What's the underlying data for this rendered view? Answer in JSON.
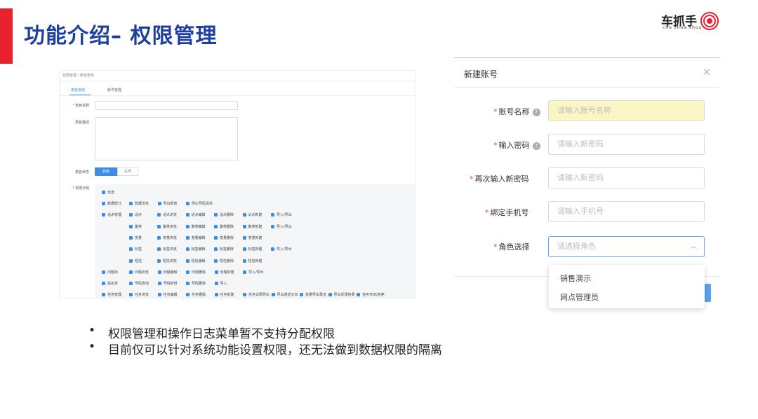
{
  "title": "功能介绍– 权限管理",
  "logo": {
    "text": "车抓手",
    "sub": "che zhua shou"
  },
  "left_panel": {
    "breadcrumb": "权限管理 / 新建角色",
    "tabs": [
      "角色管理",
      "账号管理"
    ],
    "labels": {
      "name": "角色名称",
      "desc": "角色描述",
      "status": "角色状态",
      "perm": "权限分配"
    },
    "status_on": "启用",
    "status_off": "关闭",
    "select_all": "全选",
    "rows": [
      {
        "group": "数据统计",
        "items": [
          "数据浏览",
          "导出报表",
          "导出号码清单"
        ]
      },
      {
        "group": "话术管理",
        "sub": "话术",
        "items": [
          "话术浏览",
          "话术编辑",
          "话术删除",
          "话术新建",
          "导入/导出"
        ]
      },
      {
        "sub": "聚类",
        "items": [
          "聚类浏览",
          "聚类编辑",
          "聚类删除",
          "聚类新建",
          "导入/导出"
        ]
      },
      {
        "sub": "变量",
        "items": [
          "变量浏览",
          "变量编辑",
          "变量删除",
          "变量新建"
        ]
      },
      {
        "sub": "标签",
        "items": [
          "标签浏览",
          "标签编辑",
          "标签删除",
          "标签新建",
          "导入/导出"
        ]
      },
      {
        "sub": "短信",
        "items": [
          "短信浏览",
          "短信编辑",
          "短信删除",
          "短信新建"
        ]
      },
      {
        "group": "问题库",
        "items": [
          "问题浏览",
          "问题编辑",
          "问题删除",
          "问题新建",
          "导入/导出"
        ]
      },
      {
        "group": "黑名单",
        "items": [
          "号码查询",
          "号码新增",
          "号码删除",
          "导入"
        ]
      },
      {
        "group": "任务管理",
        "items": [
          "任务浏览",
          "任务编辑",
          "任务删除",
          "任务新建",
          "任务详情导出",
          "导出通话文本",
          "批量导出录音",
          "导出反馈结果",
          "任务开启/暂停"
        ]
      }
    ]
  },
  "dialog": {
    "title": "新建账号",
    "close": "×",
    "fields": [
      {
        "label": "账号名称",
        "placeholder": "请输入账号名称",
        "help": true
      },
      {
        "label": "输入密码",
        "placeholder": "请输入新密码",
        "help": true
      },
      {
        "label": "再次输入新密码",
        "placeholder": "请输入新密码",
        "help": false
      },
      {
        "label": "绑定手机号",
        "placeholder": "请输入手机号",
        "help": false
      },
      {
        "label": "角色选择",
        "placeholder": "请选择角色",
        "help": false
      }
    ],
    "help_icon": "?",
    "options": [
      "销售演示",
      "网点管理员"
    ]
  },
  "bullets": [
    "权限管理和操作日志菜单暂不支持分配权限",
    "目前仅可以针对系统功能设置权限，还无法做到数据权限的隔离"
  ],
  "colors": {
    "accent": "#e8212e",
    "title": "#1f3fa0",
    "primary": "#3a8ee6"
  }
}
